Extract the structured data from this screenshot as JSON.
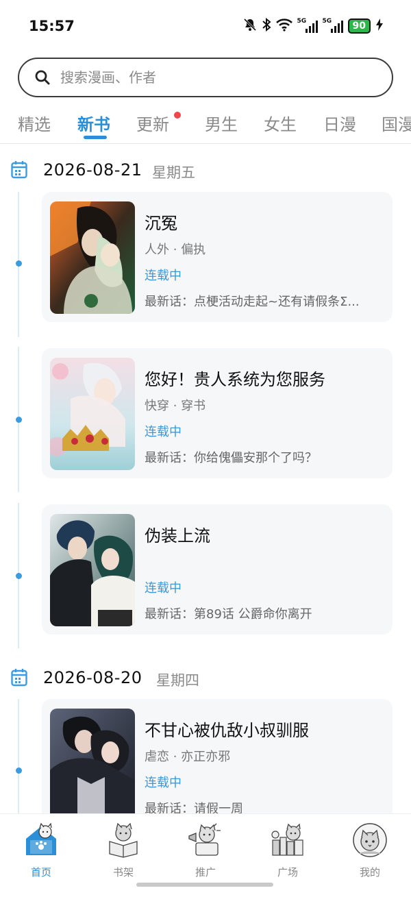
{
  "status_bar": {
    "time": "15:57",
    "net1": "5G",
    "net2": "5G",
    "battery": "90"
  },
  "search": {
    "placeholder": "搜索漫画、作者"
  },
  "tabs": [
    {
      "label": "精选"
    },
    {
      "label": "新书",
      "active": true
    },
    {
      "label": "更新",
      "badge": true
    },
    {
      "label": "男生"
    },
    {
      "label": "女生"
    },
    {
      "label": "日漫"
    },
    {
      "label": "国漫"
    }
  ],
  "sections": [
    {
      "date": "2026-08-21",
      "weekday": "星期五",
      "items": [
        {
          "title": "沉冤",
          "tags": "人外 · 偏执",
          "status": "连载中",
          "latest": "最新话：点梗活动走起~还有请假条Σ..."
        },
        {
          "title": "您好！贵人系统为您服务",
          "tags": "快穿 · 穿书",
          "status": "连载中",
          "latest": "最新话：你给傀儡安那个了吗？"
        },
        {
          "title": "伪装上流",
          "tags": "",
          "status": "连载中",
          "latest": "最新话：第89话 公爵命你离开"
        }
      ]
    },
    {
      "date": "2026-08-20",
      "weekday": "星期四",
      "items": [
        {
          "title": "不甘心被仇敌小叔驯服",
          "tags": "虐恋 · 亦正亦邪",
          "status": "连载中",
          "latest": "最新话：请假一周"
        }
      ]
    }
  ],
  "bottom_nav": [
    {
      "label": "首页",
      "icon": "home-cat-icon",
      "active": true
    },
    {
      "label": "书架",
      "icon": "bookshelf-cat-icon"
    },
    {
      "label": "推广",
      "icon": "promote-cat-icon"
    },
    {
      "label": "广场",
      "icon": "plaza-cat-icon"
    },
    {
      "label": "我的",
      "icon": "profile-cat-icon"
    }
  ],
  "colors": {
    "accent": "#2a8fd6",
    "status": "#3d98d8",
    "badge": "#f2454a",
    "battery": "#2fb64a"
  }
}
